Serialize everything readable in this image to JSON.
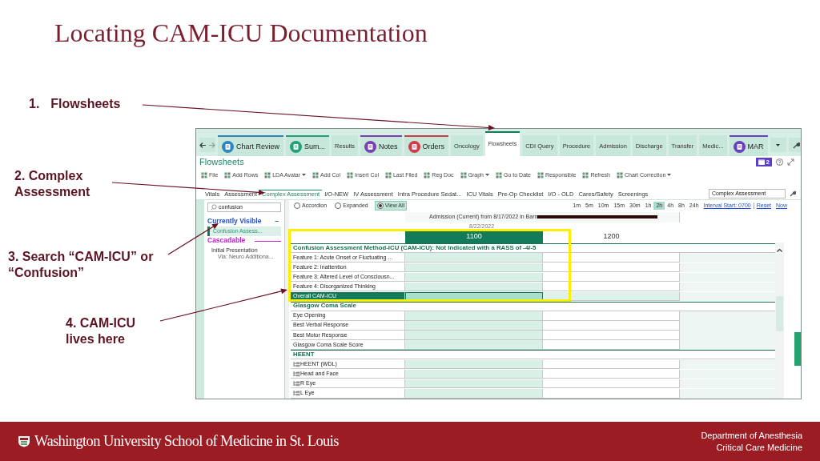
{
  "slide": {
    "title": "Locating CAM-ICU Documentation",
    "footer_logo": "Washington University School of Medicine in St. Louis",
    "footer_department": [
      "Department of Anesthesia",
      "Critical Care Medicine"
    ]
  },
  "callouts": [
    {
      "number": "1.",
      "text": "Flowsheets"
    },
    {
      "text": "2. Complex Assessment"
    },
    {
      "text": "3. Search “CAM-ICU” or “Confusion”"
    },
    {
      "text": "4. CAM-ICU lives here"
    }
  ],
  "ehr": {
    "nav_tabs": [
      {
        "label": "Chart Review",
        "kind": "icon",
        "color": "#2e86c1",
        "selected": false
      },
      {
        "label": "Sum...",
        "kind": "icon",
        "color": "#23a07a",
        "selected": false
      },
      {
        "label": "Results",
        "kind": "plain",
        "selected": false
      },
      {
        "label": "Notes",
        "kind": "icon",
        "color": "#7a3fb5",
        "selected": false
      },
      {
        "label": "Orders",
        "kind": "icon",
        "color": "#d23a4a",
        "selected": false
      },
      {
        "label": "Oncology",
        "kind": "plain",
        "selected": false
      },
      {
        "label": "Flowsheets",
        "kind": "plain",
        "color": "#137a5a",
        "selected": true
      },
      {
        "label": "CDI Query",
        "kind": "plain",
        "selected": false
      },
      {
        "label": "Procedure",
        "kind": "plain",
        "selected": false
      },
      {
        "label": "Admission",
        "kind": "plain",
        "selected": false
      },
      {
        "label": "Discharge",
        "kind": "plain",
        "selected": false
      },
      {
        "label": "Transfer",
        "kind": "plain",
        "selected": false
      },
      {
        "label": "Medic...",
        "kind": "plain",
        "selected": false
      },
      {
        "label": "MAR",
        "kind": "icon",
        "color": "#6a3fc0",
        "selected": false
      }
    ],
    "page_title": "Flowsheets",
    "notification_count": "2",
    "toolbar": [
      {
        "label": "File",
        "menu": false
      },
      {
        "label": "Add Rows",
        "menu": false
      },
      {
        "label": "LDA Avatar",
        "menu": true
      },
      {
        "label": "Add Col",
        "menu": false
      },
      {
        "label": "Insert Col",
        "menu": false
      },
      {
        "label": "Last Filed",
        "menu": false
      },
      {
        "label": "Reg Doc",
        "menu": false
      },
      {
        "label": "Graph",
        "menu": true
      },
      {
        "label": "Go to Date",
        "menu": false
      },
      {
        "label": "Responsible",
        "menu": false
      },
      {
        "label": "Refresh",
        "menu": false
      },
      {
        "label": "Chart Correction",
        "menu": true
      }
    ],
    "section_tabs": [
      {
        "label": "Vitals",
        "selected": false
      },
      {
        "label": "Assessment",
        "selected": false
      },
      {
        "label": "Complex Assessment",
        "selected": true
      },
      {
        "label": "I/O-NEW",
        "selected": false
      },
      {
        "label": "IV Assessment",
        "selected": false
      },
      {
        "label": "Intra Procedure Sedat...",
        "selected": false
      },
      {
        "label": "ICU Vitals",
        "selected": false
      },
      {
        "label": "Pre-Op Checklist",
        "selected": false
      },
      {
        "label": "I/O - OLD",
        "selected": false
      },
      {
        "label": "Cares/Safety",
        "selected": false
      },
      {
        "label": "Screenings",
        "selected": false
      }
    ],
    "section_search": {
      "value": "Complex Assessment"
    },
    "sidebar": {
      "search": {
        "value": "confusion"
      },
      "heading": "Currently Visible",
      "collapse_symbol": "–",
      "items": [
        {
          "label": "Confusion Assess...",
          "selected": true
        }
      ],
      "cascadable": "Cascadable",
      "cascade_items": [
        {
          "label": "Initial Presentation",
          "children": [
            {
              "label": "Via: Neuro Additiona..."
            }
          ]
        }
      ]
    },
    "view_modes": [
      {
        "label": "Accordion",
        "selected": false
      },
      {
        "label": "Expanded",
        "selected": false
      },
      {
        "label": "View All",
        "selected": true
      }
    ],
    "intervals": [
      {
        "label": "1m",
        "selected": false
      },
      {
        "label": "5m",
        "selected": false
      },
      {
        "label": "10m",
        "selected": false
      },
      {
        "label": "15m",
        "selected": false
      },
      {
        "label": "30m",
        "selected": false
      },
      {
        "label": "1h",
        "selected": false
      },
      {
        "label": "2h",
        "selected": true
      },
      {
        "label": "4h",
        "selected": false
      },
      {
        "label": "8h",
        "selected": false
      },
      {
        "label": "24h",
        "selected": false
      }
    ],
    "interval_start": "Interval Start: 0700",
    "reset": "Reset",
    "now": "Now",
    "encounter": "Admission (Current) from 8/17/2022 in Barn",
    "date": "8/22/2022",
    "times": [
      {
        "label": "1100",
        "selected": true
      },
      {
        "label": "1200",
        "selected": false
      }
    ],
    "groups": [
      {
        "title": "Confusion Assessment Method-ICU (CAM-ICU): Not Indicated with a RASS of -4/-5",
        "highlighted": true,
        "rows": [
          {
            "label": "Feature 1: Acute Onset or Fluctuating ...",
            "kind": "plain",
            "selected": false
          },
          {
            "label": "Feature 2: Inattention",
            "kind": "plain",
            "selected": false
          },
          {
            "label": "Feature 3: Altered Level of Consciousn...",
            "kind": "plain",
            "selected": false
          },
          {
            "label": "Feature 4: Disorganized Thinking",
            "kind": "plain",
            "selected": false
          },
          {
            "label": "Overall CAM-ICU",
            "kind": "plain",
            "selected": true
          }
        ]
      },
      {
        "title": "Glasgow Coma Scale",
        "highlighted": false,
        "rows": [
          {
            "label": "Eye Opening",
            "kind": "plain",
            "selected": false
          },
          {
            "label": "Best Verbal Response",
            "kind": "plain",
            "selected": false
          },
          {
            "label": "Best Motor Response",
            "kind": "plain",
            "selected": false
          },
          {
            "label": "Glasgow Coma Scale Score",
            "kind": "plain",
            "selected": false
          }
        ]
      },
      {
        "title": "HEENT",
        "highlighted": false,
        "rows": [
          {
            "label": "HEENT (WDL)",
            "kind": "tree",
            "selected": false
          },
          {
            "label": "Head and Face",
            "kind": "tree",
            "selected": false
          },
          {
            "label": "R Eye",
            "kind": "tree",
            "selected": false
          },
          {
            "label": "L Eye",
            "kind": "tree",
            "selected": false
          }
        ]
      }
    ]
  }
}
